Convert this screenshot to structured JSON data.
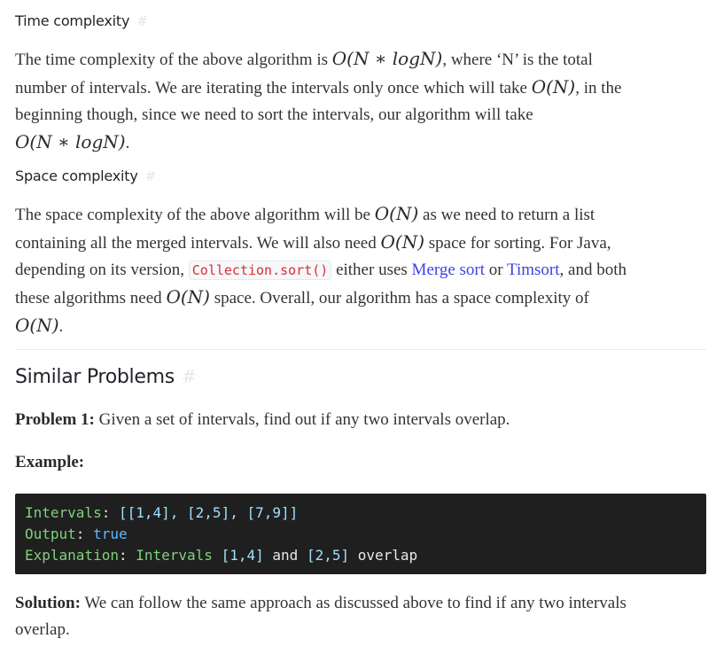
{
  "time_complexity": {
    "heading": "Time complexity",
    "anchor": "#",
    "l1_a": "The time complexity of the above algorithm is ",
    "math_nlogn": "O(N ∗ logN)",
    "l1_b": ", where ‘N’ is the total",
    "l2_a": "number of intervals. We are iterating the intervals only once which will take ",
    "math_n": "O(N)",
    "l2_b": ", in the",
    "l3": "beginning though, since we need to sort the intervals, our algorithm will take",
    "l4_math": "O(N ∗ logN)",
    "l4_end": "."
  },
  "space_complexity": {
    "heading": "Space complexity",
    "anchor": "#",
    "l1_a": "The space complexity of the above algorithm will be ",
    "math_n": "O(N)",
    "l1_b": " as we need to return a list",
    "l2_a": "containing all the merged intervals. We will also need ",
    "l2_b": " space for sorting. For Java,",
    "l3_a": "depending on its version, ",
    "code": "Collection.sort()",
    "l3_b": " either uses ",
    "link1": "Merge sort",
    "l3_c": " or ",
    "link2": "Timsort",
    "l3_d": ", and both",
    "l4_a": "these algorithms need ",
    "l4_b": " space. Overall, our algorithm has a space complexity of",
    "l5_end": "."
  },
  "similar": {
    "heading": "Similar Problems",
    "anchor": "#",
    "problem_label": "Problem 1:",
    "problem_text": " Given a set of intervals, find out if any two intervals overlap.",
    "example_label": "Example:",
    "code": {
      "intervals_key": "Intervals",
      "intervals_val": "[[1,4], [2,5], [7,9]]",
      "output_key": "Output",
      "output_val": "true",
      "explanation_key": "Explanation",
      "explanation_val_word": "Intervals",
      "explanation_val_a": "[1,4]",
      "explanation_and": "and",
      "explanation_val_b": "[2,5]",
      "explanation_overlap": "overlap"
    },
    "solution_label": "Solution:",
    "solution_l1": " We can follow the same approach as discussed above to find if any two intervals",
    "solution_l2": "overlap."
  }
}
